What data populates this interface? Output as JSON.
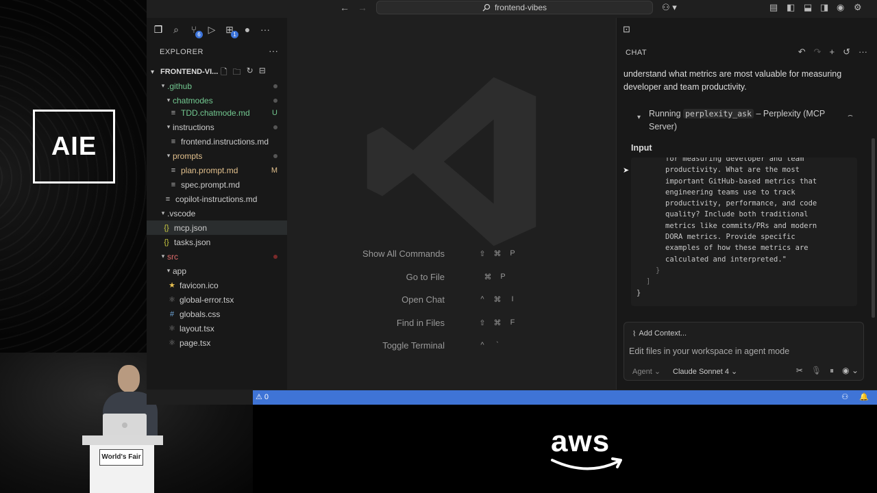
{
  "branding": {
    "event_logo": "AIE",
    "sponsor_logo": "aws",
    "podium_sign": "World's Fair"
  },
  "titlebar": {
    "search_text": "frontend-vibes",
    "search_icon": "search-icon"
  },
  "sidebar": {
    "explorer_title": "EXPLORER",
    "folder_name": "FRONTEND-VI...",
    "tabs": [
      {
        "icon": "files-icon",
        "badge": ""
      },
      {
        "icon": "search-icon",
        "badge": ""
      },
      {
        "icon": "source-control-icon",
        "badge": "6"
      },
      {
        "icon": "run-debug-icon",
        "badge": ""
      },
      {
        "icon": "extensions-icon",
        "badge": "1"
      },
      {
        "icon": "github-icon",
        "badge": ""
      }
    ],
    "tree": [
      {
        "label": ".github",
        "type": "folder",
        "status": "dot"
      },
      {
        "label": "chatmodes",
        "type": "folder",
        "status": "dot"
      },
      {
        "label": "TDD.chatmode.md",
        "type": "md",
        "status": "U"
      },
      {
        "label": "instructions",
        "type": "folder",
        "status": "dot"
      },
      {
        "label": "frontend.instructions.md",
        "type": "md",
        "status": ""
      },
      {
        "label": "prompts",
        "type": "folder",
        "status": "dot"
      },
      {
        "label": "plan.prompt.md",
        "type": "md",
        "status": "M"
      },
      {
        "label": "spec.prompt.md",
        "type": "md",
        "status": ""
      },
      {
        "label": "copilot-instructions.md",
        "type": "md",
        "status": ""
      },
      {
        "label": ".vscode",
        "type": "folder",
        "status": ""
      },
      {
        "label": "mcp.json",
        "type": "json",
        "status": ""
      },
      {
        "label": "tasks.json",
        "type": "json",
        "status": ""
      },
      {
        "label": "src",
        "type": "folder",
        "status": "dot"
      },
      {
        "label": "app",
        "type": "folder",
        "status": ""
      },
      {
        "label": "favicon.ico",
        "type": "ico",
        "status": ""
      },
      {
        "label": "global-error.tsx",
        "type": "tsx",
        "status": ""
      },
      {
        "label": "globals.css",
        "type": "css",
        "status": ""
      },
      {
        "label": "layout.tsx",
        "type": "tsx",
        "status": ""
      },
      {
        "label": "page.tsx",
        "type": "tsx",
        "status": ""
      }
    ]
  },
  "editor": {
    "shortcuts": [
      {
        "label": "Show All Commands",
        "keys": [
          "⇧",
          "⌘",
          "P"
        ]
      },
      {
        "label": "Go to File",
        "keys": [
          "⌘",
          "P"
        ]
      },
      {
        "label": "Open Chat",
        "keys": [
          "^",
          "⌘",
          "I"
        ]
      },
      {
        "label": "Find in Files",
        "keys": [
          "⇧",
          "⌘",
          "F"
        ]
      },
      {
        "label": "Toggle Terminal",
        "keys": [
          "^",
          "`"
        ]
      }
    ]
  },
  "chat": {
    "header": "CHAT",
    "intro": "understand what metrics are most valuable for measuring developer and team productivity.",
    "tool": {
      "running_prefix": "Running",
      "tool_name": "perplexity_ask",
      "running_suffix": "– Perplexity (MCP Server)"
    },
    "input_label": "Input",
    "input_code": [
      "for measuring developer and team",
      "productivity. What are the most",
      "important GitHub-based metrics that",
      "engineering teams use to track",
      "productivity, performance, and code",
      "quality? Include both traditional",
      "metrics like commits/PRs and modern",
      "DORA metrics. Provide specific",
      "examples of how these metrics are",
      "calculated and interpreted.\""
    ],
    "input_closers": [
      "}",
      "]",
      "}"
    ],
    "add_context": "Add Context...",
    "placeholder": "Edit files in your workspace in agent mode",
    "mode": "Agent",
    "model": "Claude Sonnet 4"
  },
  "statusbar": {
    "problems": "0"
  }
}
